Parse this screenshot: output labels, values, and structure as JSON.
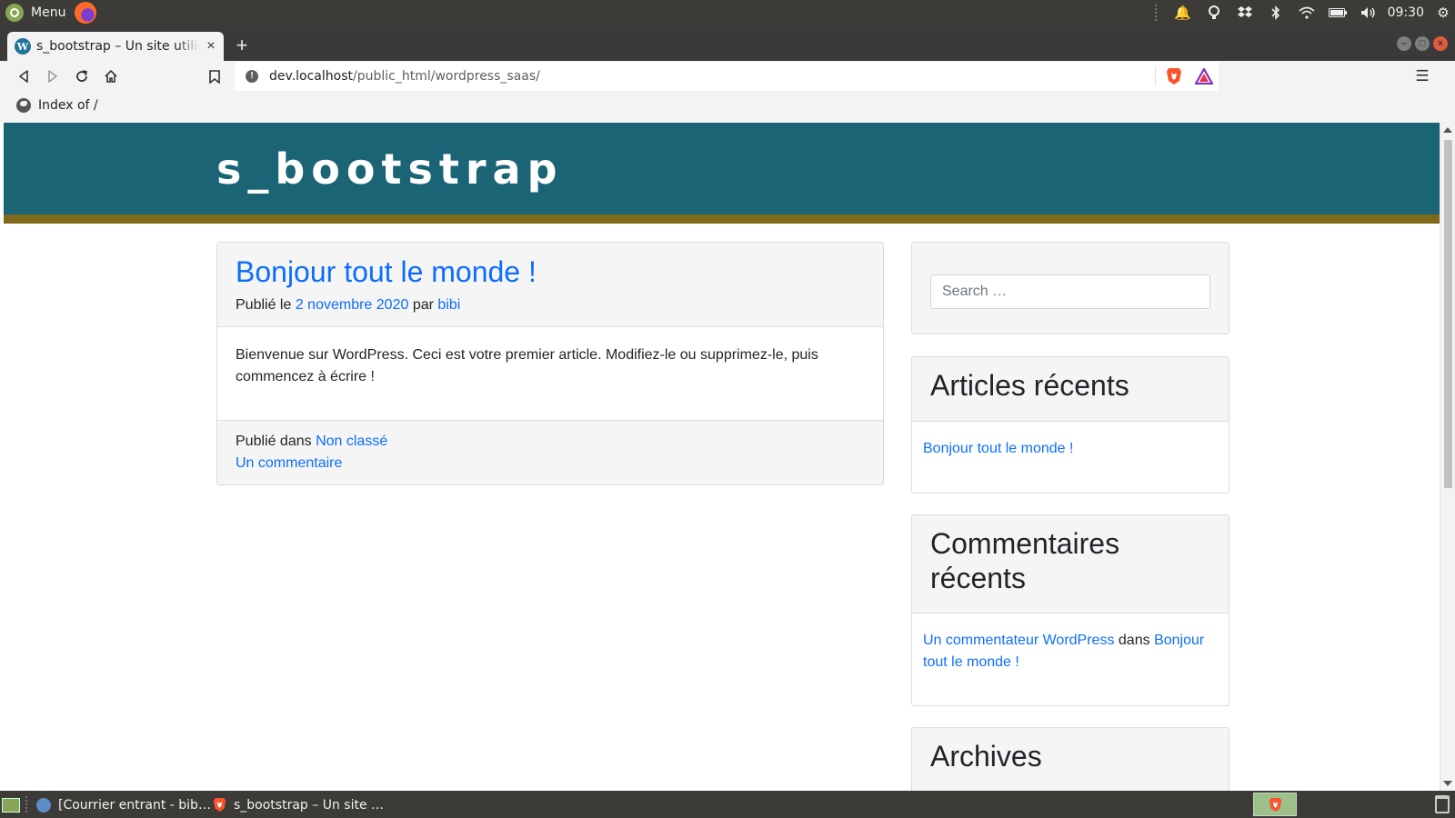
{
  "os_panel": {
    "menu_label": "Menu",
    "clock": "09:30",
    "tray_icons": [
      "notification-bell-icon",
      "lightbulb-icon",
      "dropbox-icon",
      "bluetooth-icon",
      "wifi-icon",
      "battery-icon",
      "volume-icon",
      "settings-icon"
    ]
  },
  "browser": {
    "tab_title": "s_bootstrap – Un site utilisant WordPress",
    "new_tab_label": "+",
    "url": {
      "host": "dev.localhost",
      "path": "/public_html/wordpress_saas/"
    },
    "bookmark_label": "Index of /"
  },
  "site": {
    "title": "s_bootstrap",
    "colors": {
      "header": "#1a6476",
      "stripe": "#7e6a1a",
      "link": "#0d6efd"
    }
  },
  "article": {
    "title": "Bonjour tout le monde !",
    "meta_published": "Publié le",
    "meta_date": "2 novembre 2020",
    "meta_by": "par",
    "meta_author": "bibi",
    "body": "Bienvenue sur WordPress. Ceci est votre premier article. Modifiez-le ou supprimez-le, puis commencez à écrire !",
    "footer_published_in": "Publié dans",
    "category": "Non classé",
    "comments_link": "Un commentaire"
  },
  "sidebar": {
    "search_placeholder": "Search …",
    "recent_posts_title": "Articles récents",
    "recent_posts": [
      "Bonjour tout le monde !"
    ],
    "recent_comments_title": "Commentaires récents",
    "comment_author": "Un commentateur WordPress",
    "comment_in": "dans",
    "comment_post": "Bonjour tout le monde !",
    "archives_title": "Archives"
  },
  "taskbar": {
    "items": [
      "[Courrier entrant - bib…",
      "s_bootstrap – Un site …"
    ]
  }
}
